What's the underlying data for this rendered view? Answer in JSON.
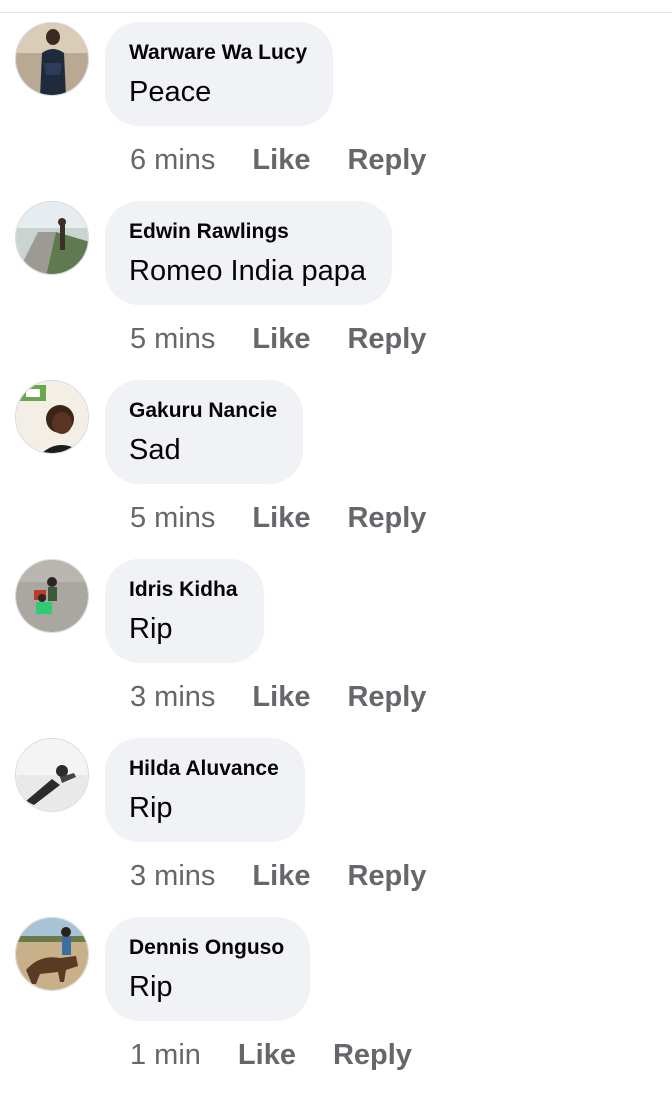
{
  "comments": [
    {
      "author": "Warware Wa Lucy",
      "text": "Peace",
      "time": "6 mins",
      "like_label": "Like",
      "reply_label": "Reply"
    },
    {
      "author": "Edwin Rawlings",
      "text": "Romeo India papa",
      "time": "5 mins",
      "like_label": "Like",
      "reply_label": "Reply"
    },
    {
      "author": "Gakuru Nancie",
      "text": "Sad",
      "time": "5 mins",
      "like_label": "Like",
      "reply_label": "Reply"
    },
    {
      "author": "Idris Kidha",
      "text": "Rip",
      "time": "3 mins",
      "like_label": "Like",
      "reply_label": "Reply"
    },
    {
      "author": "Hilda Aluvance",
      "text": "Rip",
      "time": "3 mins",
      "like_label": "Like",
      "reply_label": "Reply"
    },
    {
      "author": "Dennis Onguso",
      "text": "Rip",
      "time": "1 min",
      "like_label": "Like",
      "reply_label": "Reply"
    }
  ],
  "colors": {
    "bubble_bg": "#f0f2f5",
    "name_text": "#050505",
    "meta_text": "#65676b"
  }
}
